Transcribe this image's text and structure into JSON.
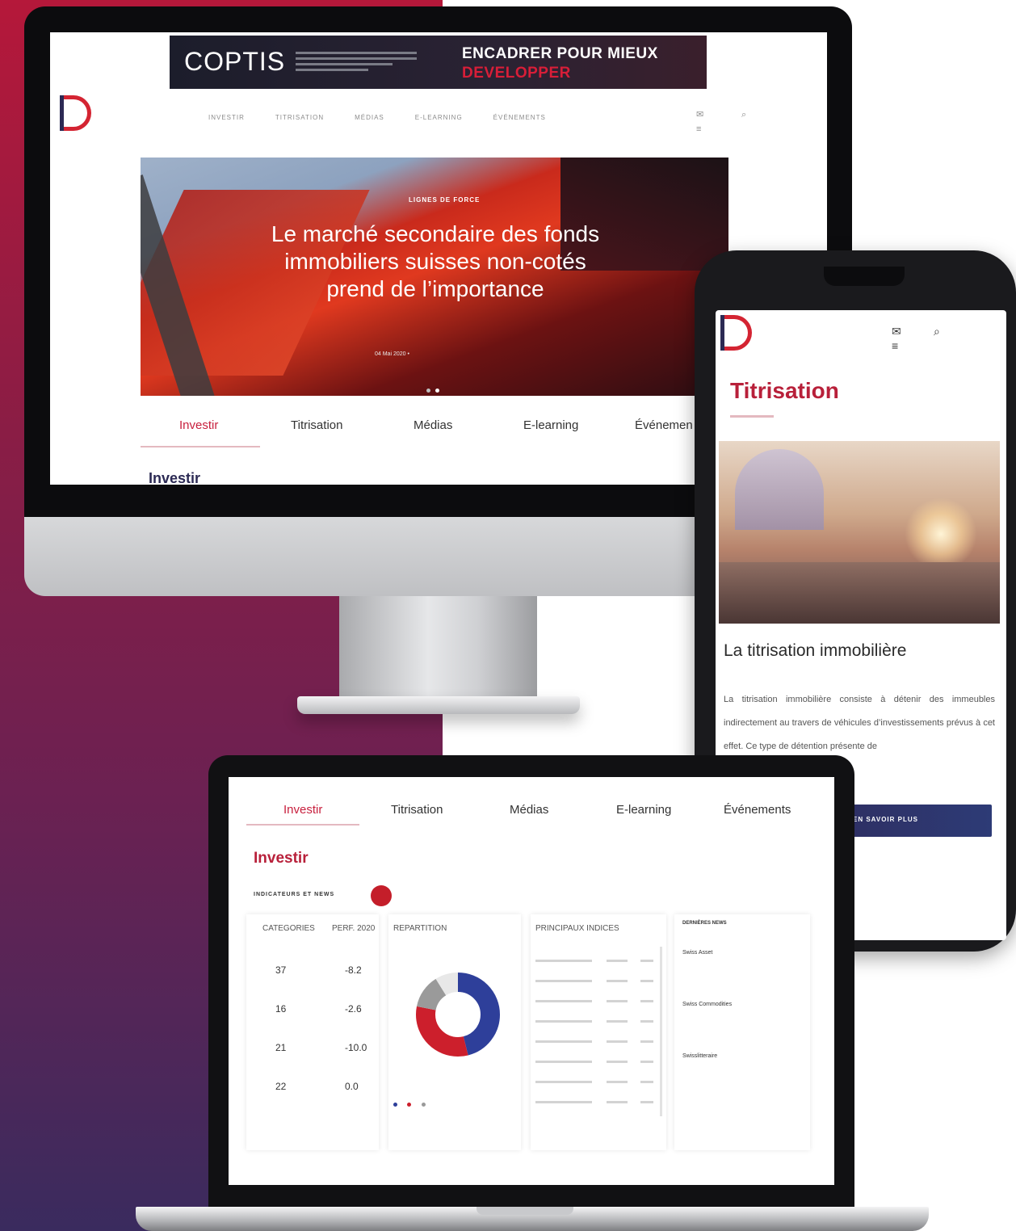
{
  "colors": {
    "brand_red": "#c8203e",
    "brand_navy": "#2c2a54",
    "bg_gradient_top": "#b5183a",
    "bg_gradient_bottom": "#3a2b5e"
  },
  "imac": {
    "ad": {
      "brand": "COPTIS",
      "headline_line1": "ENCADRER POUR MIEUX",
      "headline_line2": "DEVELOPPER"
    },
    "nav": [
      "INVESTIR",
      "TITRISATION",
      "MÉDIAS",
      "E-LEARNING",
      "ÉVÉNEMENTS"
    ],
    "header_icons": [
      "mail-icon",
      "search-icon",
      "menu-icon"
    ],
    "hero": {
      "tag": "LIGNES DE FORCE",
      "title": "Le marché secondaire des fonds immobiliers suisses non-cotés prend de l’importance",
      "meta": "04 Mai 2020 •",
      "dots": 2,
      "active_dot": 2
    },
    "tabs": [
      "Investir",
      "Titrisation",
      "Médias",
      "E-learning",
      "Événemen"
    ],
    "active_tab": 0,
    "section_title": "Investir"
  },
  "phone": {
    "icons": [
      "mail-icon",
      "search-icon",
      "menu-icon"
    ],
    "title": "Titrisation",
    "article_title": "La titrisation immobilière",
    "article_body": "La titrisation immobilière consiste à détenir des immeubles indirectement au travers de véhicules d’investissements prévus à cet effet. Ce type de détention présente de",
    "cta": "EN SAVOIR PLUS"
  },
  "laptop": {
    "tabs": [
      "Investir",
      "Titrisation",
      "Médias",
      "E-learning",
      "Événements"
    ],
    "active_tab": 0,
    "title": "Investir",
    "indicators_label": "INDICATEURS ET NEWS",
    "categories": {
      "header_left": "CATEGORIES",
      "header_right": "PERF. 2020",
      "rows": [
        {
          "count": "37",
          "perf": "-8.2"
        },
        {
          "count": "16",
          "perf": "-2.6"
        },
        {
          "count": "21",
          "perf": "-10.0"
        },
        {
          "count": "22",
          "perf": "0.0"
        }
      ]
    },
    "repartition": {
      "header": "REPARTITION",
      "segments": [
        {
          "value": 46,
          "color": "#2e3f9a"
        },
        {
          "value": 32,
          "color": "#cc1f2c"
        },
        {
          "value": 13,
          "color": "#9a9a9a"
        },
        {
          "value": 9,
          "color": "#e8e8e8"
        }
      ],
      "legend_colors": [
        "#2e3f9a",
        "#cc1f2c",
        "#9a9a9a"
      ]
    },
    "indices": {
      "header": "PRINCIPAUX INDICES",
      "rows": 8
    },
    "news": {
      "header": "DERNIÈRES NEWS",
      "items": [
        "Swiss Asset",
        "Swiss Commodities",
        "Swisslitteraire"
      ]
    }
  }
}
